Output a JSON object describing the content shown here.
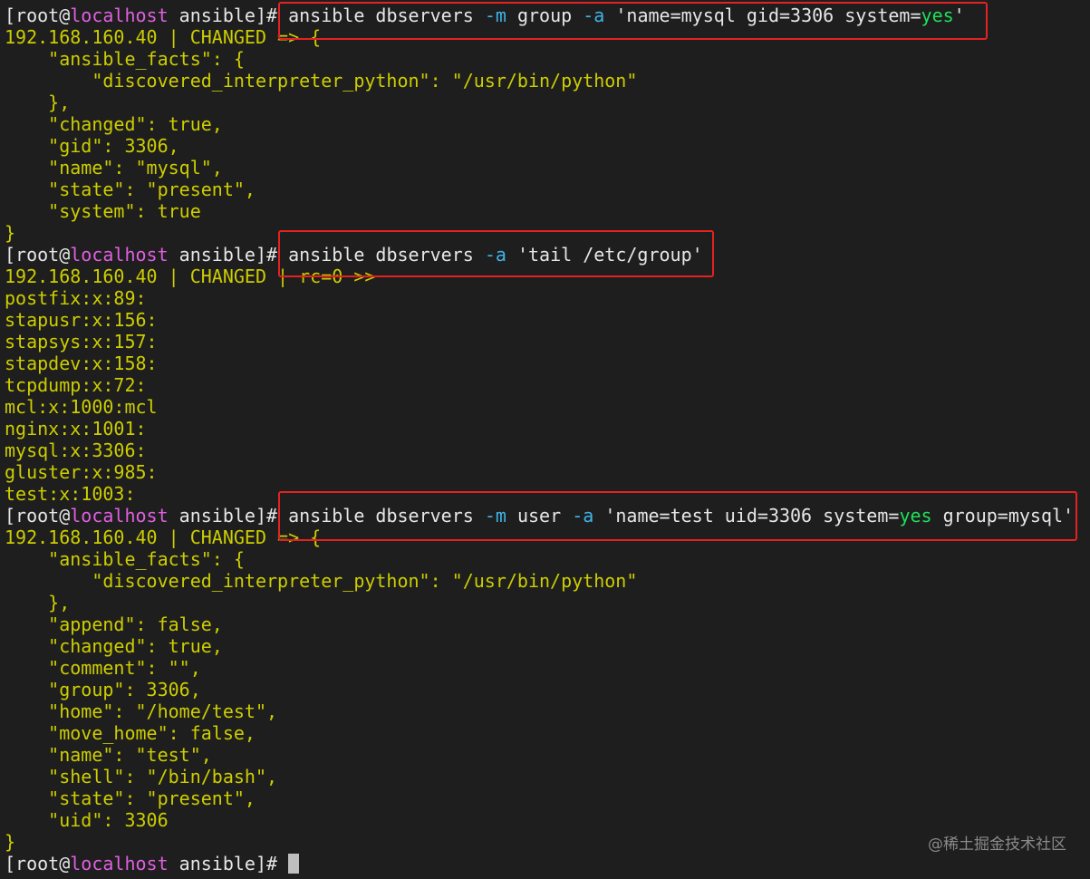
{
  "prompt": {
    "open": "[",
    "user": "root",
    "at": "@",
    "host": "localhost",
    "rest": " ansible]#"
  },
  "cmd1": {
    "p1": " ansible dbservers ",
    "flag_m": "-m",
    "p2": " group ",
    "flag_a": "-a",
    "p3": " 'name=mysql gid=3306 system=",
    "yes": "yes",
    "p4": "'"
  },
  "cmd2": {
    "p1": " ansible dbservers ",
    "flag_a": "-a",
    "p2": " 'tail /etc/group'"
  },
  "cmd3": {
    "p1": " ansible dbservers ",
    "flag_m": "-m",
    "p2": " user ",
    "flag_a": "-a",
    "p3": " 'name=test uid=3306 system=",
    "yes": "yes",
    "p4": " group=mysql'"
  },
  "output1": [
    "192.168.160.40 | CHANGED => {",
    "    \"ansible_facts\": {",
    "        \"discovered_interpreter_python\": \"/usr/bin/python\"",
    "    },",
    "    \"changed\": true,",
    "    \"gid\": 3306,",
    "    \"name\": \"mysql\",",
    "    \"state\": \"present\",",
    "    \"system\": true",
    "}"
  ],
  "output2": [
    "192.168.160.40 | CHANGED | rc=0 >>",
    "postfix:x:89:",
    "stapusr:x:156:",
    "stapsys:x:157:",
    "stapdev:x:158:",
    "tcpdump:x:72:",
    "mcl:x:1000:mcl",
    "nginx:x:1001:",
    "mysql:x:3306:",
    "gluster:x:985:",
    "test:x:1003:"
  ],
  "output3": [
    "192.168.160.40 | CHANGED => {",
    "    \"ansible_facts\": {",
    "        \"discovered_interpreter_python\": \"/usr/bin/python\"",
    "    },",
    "    \"append\": false,",
    "    \"changed\": true,",
    "    \"comment\": \"\",",
    "    \"group\": 3306,",
    "    \"home\": \"/home/test\",",
    "    \"move_home\": false,",
    "    \"name\": \"test\",",
    "    \"shell\": \"/bin/bash\",",
    "    \"state\": \"present\",",
    "    \"uid\": 3306",
    "}"
  ],
  "watermark": "@稀土掘金技术社区",
  "colors": {
    "background": "#1e1e1e",
    "output": "#cdcd00",
    "host": "#e05fe0",
    "flag": "#3fb4e8",
    "yes": "#1ee05a",
    "highlight_box": "#e32222"
  }
}
